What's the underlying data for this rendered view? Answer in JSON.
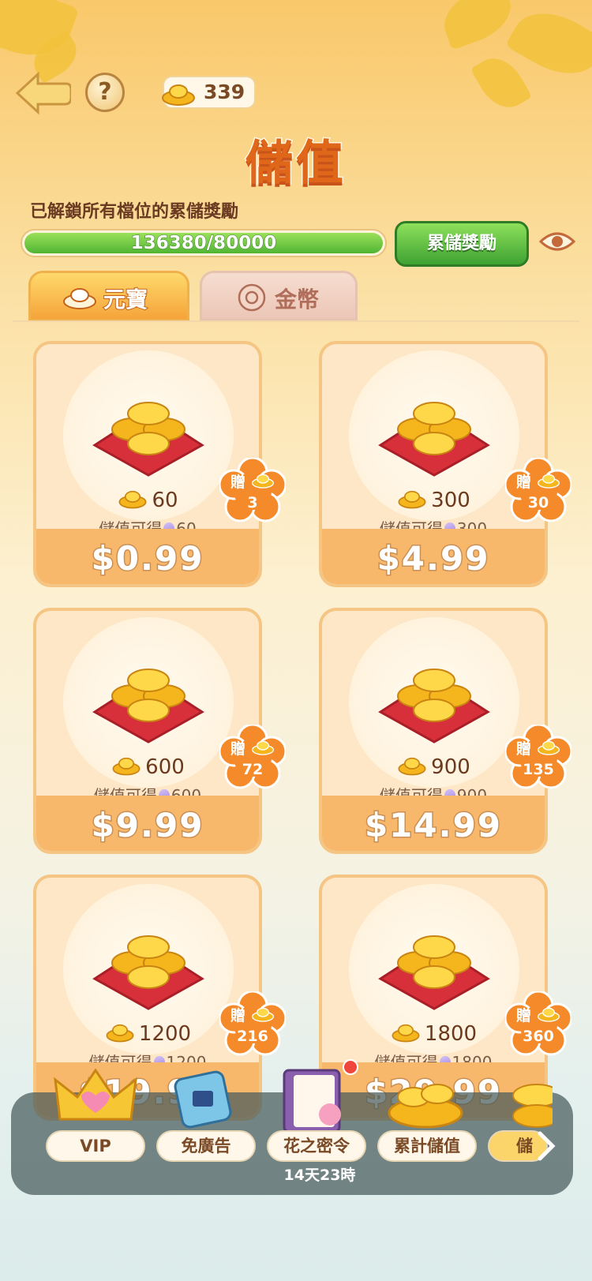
{
  "header": {
    "back_icon": "arrow-left-icon",
    "help_label": "?",
    "balance": "339",
    "title": "儲值"
  },
  "progress": {
    "message": "已解鎖所有檔位的累儲獎勵",
    "label": "136380/80000",
    "fill_fraction": 1.0,
    "reward_button": "累儲獎勵",
    "eye_icon": "eye-icon"
  },
  "tabs": [
    {
      "label": "元寶",
      "active": true
    },
    {
      "label": "金幣",
      "active": false
    }
  ],
  "products": [
    {
      "amount": "60",
      "vip_label": "儲值可得",
      "vip_amount": "60",
      "price": "$0.99",
      "bonus_label": "贈",
      "bonus": "3"
    },
    {
      "amount": "300",
      "vip_label": "儲值可得",
      "vip_amount": "300",
      "price": "$4.99",
      "bonus_label": "贈",
      "bonus": "30"
    },
    {
      "amount": "600",
      "vip_label": "儲值可得",
      "vip_amount": "600",
      "price": "$9.99",
      "bonus_label": "贈",
      "bonus": "72"
    },
    {
      "amount": "900",
      "vip_label": "儲值可得",
      "vip_amount": "900",
      "price": "$14.99",
      "bonus_label": "贈",
      "bonus": "135"
    },
    {
      "amount": "1200",
      "vip_label": "儲值可得",
      "vip_amount": "1200",
      "price": "$19.99",
      "bonus_label": "贈",
      "bonus": "216"
    },
    {
      "amount": "1800",
      "vip_label": "儲值可得",
      "vip_amount": "1800",
      "price": "$29.99",
      "bonus_label": "贈",
      "bonus": "360"
    }
  ],
  "bottom_nav": {
    "items": [
      {
        "label": "VIP"
      },
      {
        "label": "免廣告"
      },
      {
        "label": "花之密令"
      },
      {
        "label": "累計儲值"
      },
      {
        "label": "儲"
      }
    ],
    "timer": "14天23時"
  },
  "colors": {
    "accent_orange": "#e0661a",
    "green": "#4fb533",
    "card_bg": "#fde7c6",
    "price_bar": "#f7b86b"
  }
}
